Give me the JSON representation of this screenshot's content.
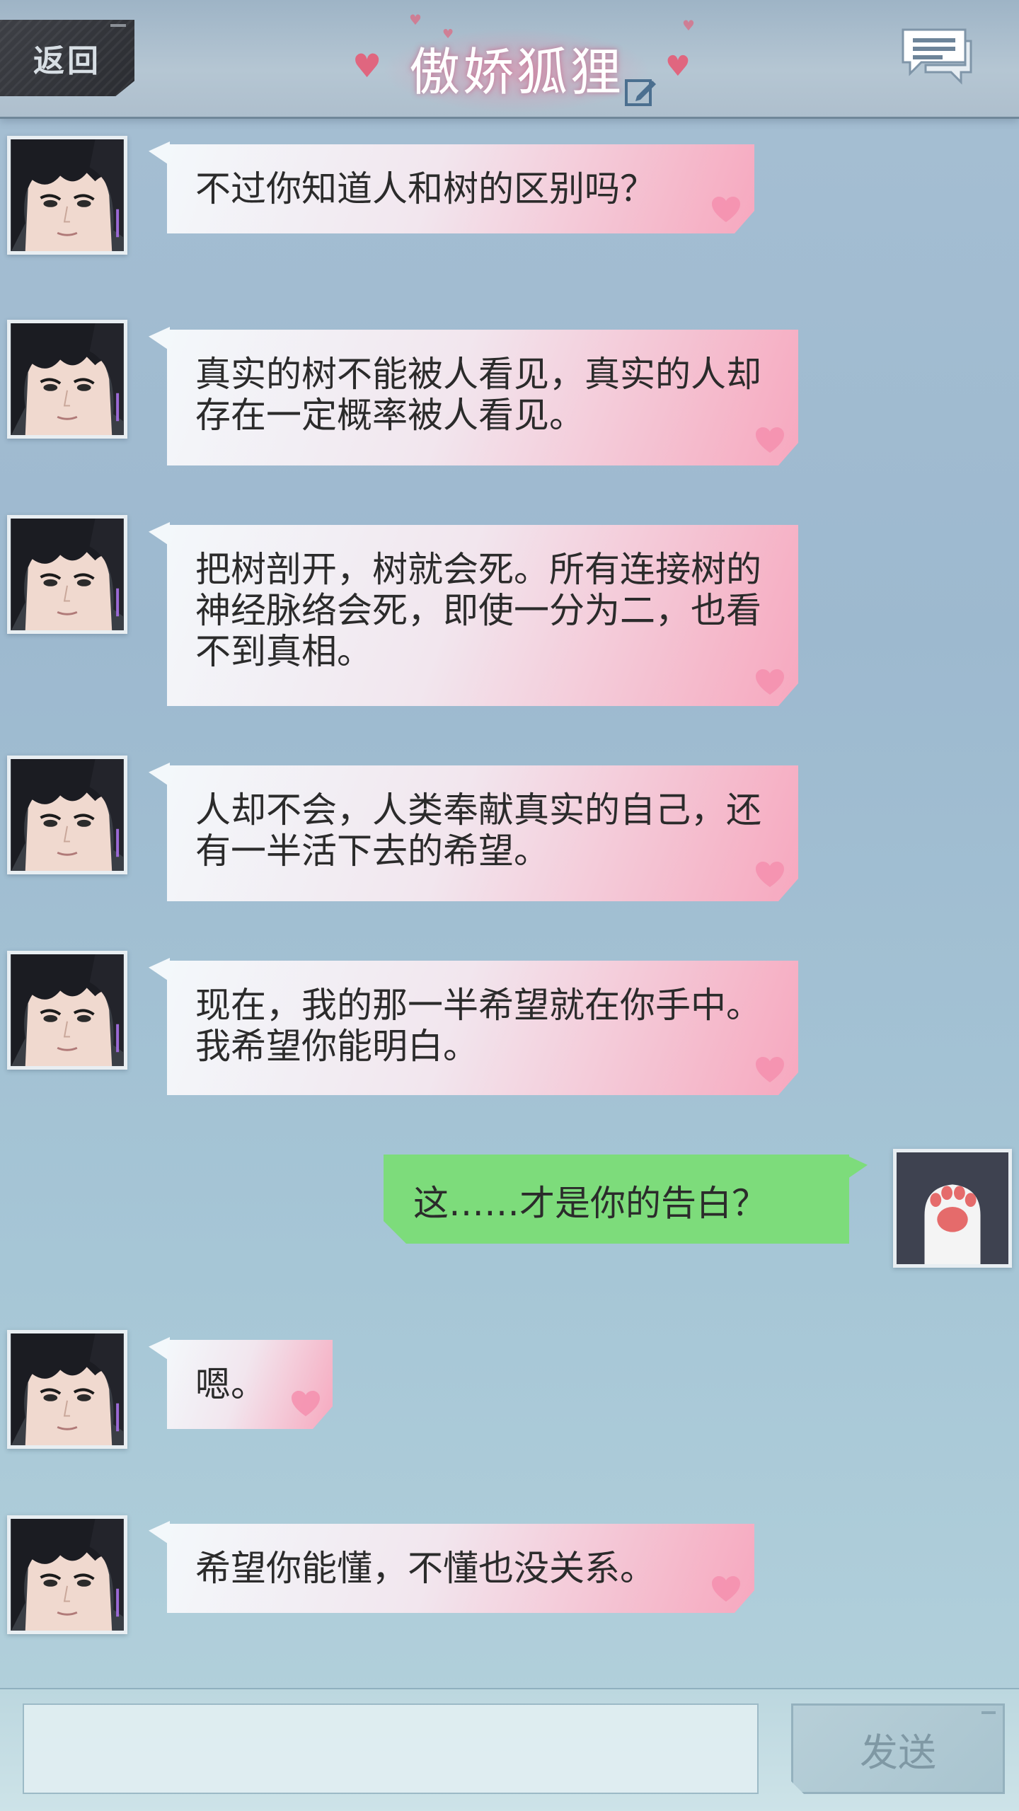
{
  "header": {
    "back_label": "返回",
    "title": "傲娇狐狸"
  },
  "messages": [
    {
      "side": "received",
      "text": "不过你知道人和树的区别吗？"
    },
    {
      "side": "received",
      "text": "真实的树不能被人看见，真实的人却存在一定概率被人看见。"
    },
    {
      "side": "received",
      "text": "把树剖开，树就会死。所有连接树的神经脉络会死，即使一分为二，也看不到真相。"
    },
    {
      "side": "received",
      "text": "人却不会，人类奉献真实的自己，还有一半活下去的希望。"
    },
    {
      "side": "received",
      "text": "现在，我的那一半希望就在你手中。我希望你能明白。"
    },
    {
      "side": "sent",
      "text": "这……才是你的告白？"
    },
    {
      "side": "received",
      "text": "嗯。"
    },
    {
      "side": "received",
      "text": "希望你能懂，不懂也没关系。"
    }
  ],
  "input": {
    "value": "",
    "send_label": "发送"
  },
  "colors": {
    "accent_pink": "#f7a8bf",
    "sent_bubble": "#7ddc7b",
    "header_dark": "#2a2c31"
  },
  "icons": {
    "back": "back-button",
    "edit": "edit-icon",
    "chat": "chat-bubbles-icon",
    "heart": "heart-icon"
  }
}
